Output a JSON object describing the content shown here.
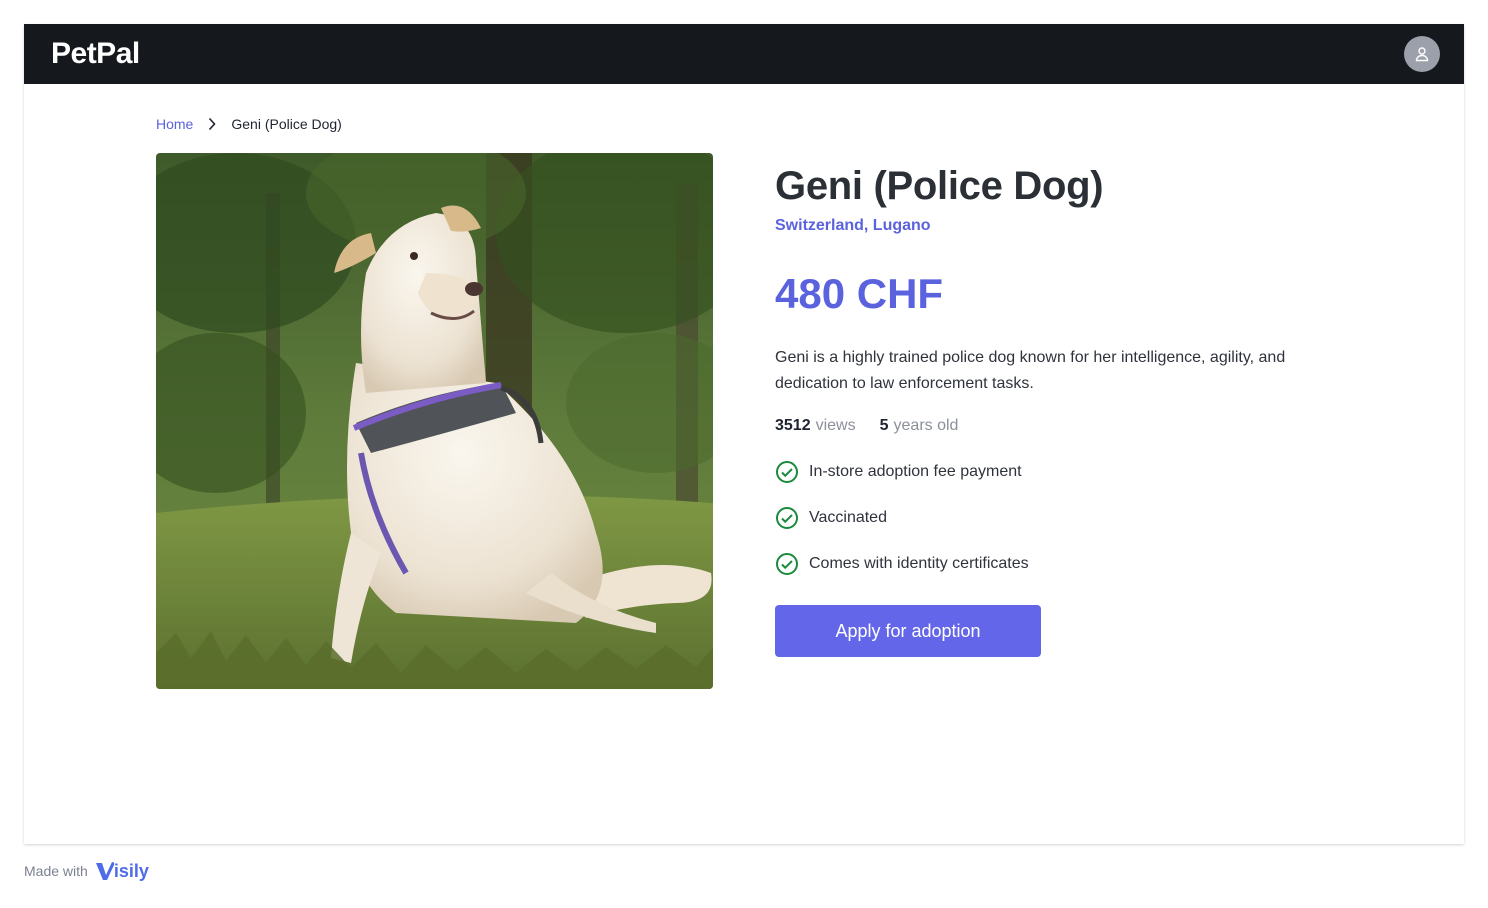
{
  "app": {
    "name": "PetPal"
  },
  "breadcrumb": {
    "home": "Home",
    "current": "Geni (Police Dog)"
  },
  "pet": {
    "name": "Geni (Police Dog)",
    "location": "Switzerland, Lugano",
    "price": "480 CHF",
    "description": "Geni is a highly trained police dog known for her intelligence, agility, and dedication to law enforcement tasks.",
    "views_count": "3512",
    "views_unit": "views",
    "age_count": "5",
    "age_unit": "years old",
    "features": [
      "In-store adoption fee payment",
      "Vaccinated",
      "Comes with identity certificates"
    ],
    "apply_label": "Apply for adoption"
  },
  "footer": {
    "made_with": "Made with",
    "brand": "isily"
  },
  "colors": {
    "navbar": "#15181d",
    "accent": "#5b62dd",
    "button": "#6366e8",
    "check": "#1a8a3c"
  },
  "icons": {
    "avatar": "user-icon",
    "breadcrumb_separator": "chevron-right-icon",
    "feature": "check-circle-icon"
  }
}
